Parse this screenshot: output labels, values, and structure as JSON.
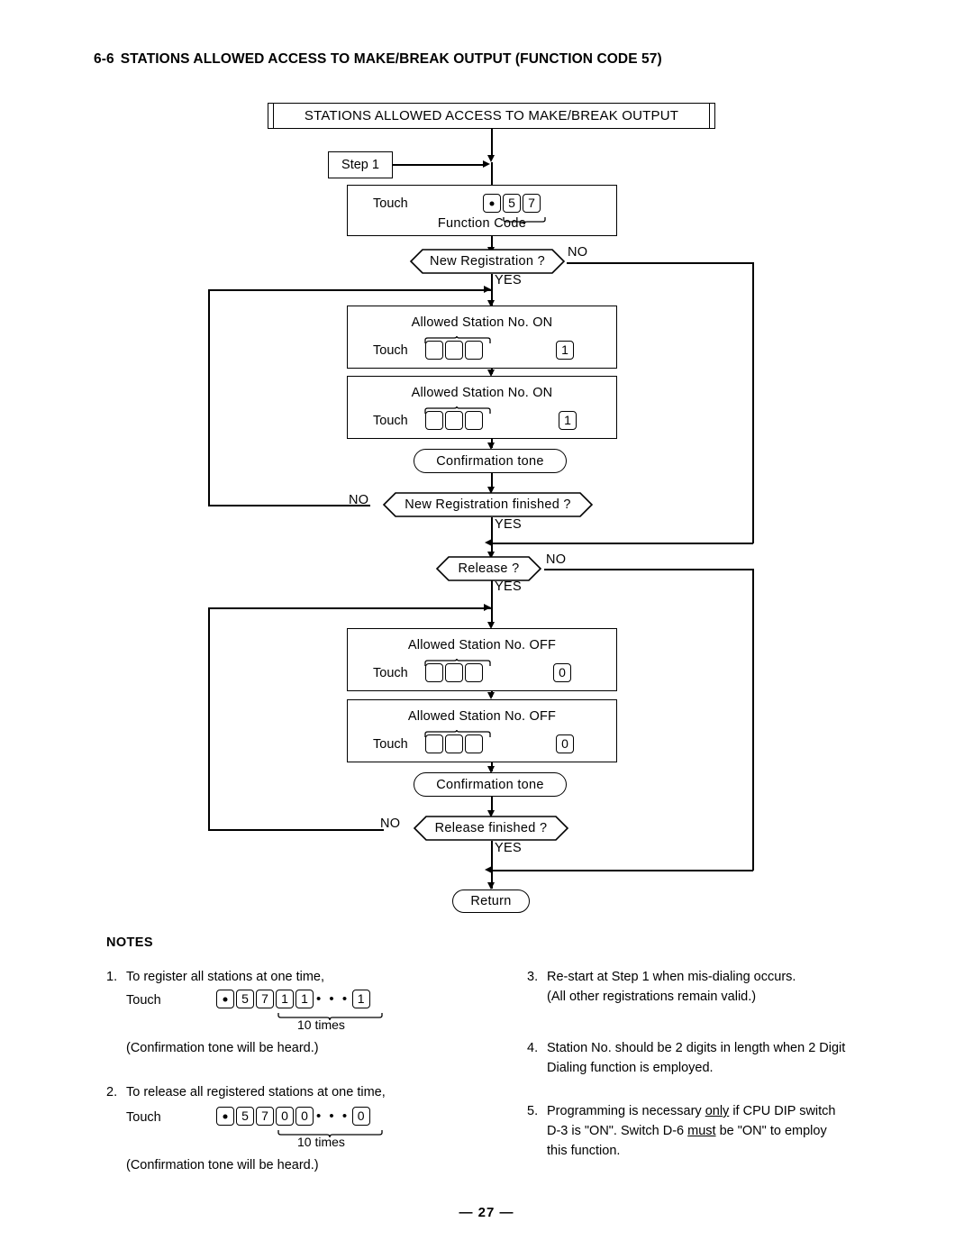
{
  "document": {
    "section_number": "6-6",
    "section_title": "STATIONS ALLOWED ACCESS TO  MAKE/BREAK  OUTPUT (FUNCTION CODE 57)",
    "page_number": "— 27 —"
  },
  "flow": {
    "header": "STATIONS ALLOWED ACCESS TO MAKE/BREAK OUTPUT",
    "step_label": "Step  1",
    "touch_label": "Touch",
    "function_code": {
      "keys": [
        "•",
        "5",
        "7"
      ],
      "brace_caption": "Function Code"
    },
    "decisions": {
      "new_registration": {
        "label": "New Registration ?",
        "yes": "YES",
        "no": "NO"
      },
      "new_registration_finished": {
        "label": "New  Registration  finished  ?",
        "yes": "YES",
        "no": "NO"
      },
      "release": {
        "label": "Release  ?",
        "yes": "YES",
        "no": "NO"
      },
      "release_finished": {
        "label": "Release  finished  ?",
        "yes": "YES",
        "no": "NO"
      }
    },
    "on_box_1": {
      "heading": "Allowed  Station  No.   ON",
      "touch": "Touch",
      "station_keys": [
        "",
        "",
        ""
      ],
      "state_key": "1"
    },
    "on_box_2": {
      "heading": "Allowed  Station  No.   ON",
      "touch": "Touch",
      "station_keys": [
        "",
        "",
        ""
      ],
      "state_key": "1"
    },
    "off_box_1": {
      "heading": "Allowed  Station  No.  OFF",
      "touch": "Touch",
      "station_keys": [
        "",
        "",
        ""
      ],
      "state_key": "0"
    },
    "off_box_2": {
      "heading": "Allowed  Station  No.  OFF",
      "touch": "Touch",
      "station_keys": [
        "",
        "",
        ""
      ],
      "state_key": "0"
    },
    "confirmation_tone_1": "Confirmation  tone",
    "confirmation_tone_2": "Confirmation  tone",
    "return": "Return"
  },
  "notes": {
    "heading": "NOTES",
    "items": [
      {
        "num": "1.",
        "text": "To register all stations at one time,",
        "touch": "Touch",
        "keys": [
          "•",
          "5",
          "7",
          "1",
          "1"
        ],
        "ellipsis": "• • •",
        "tail_key": "1",
        "brace_caption": "10 times",
        "footer": "(Confirmation tone will be heard.)"
      },
      {
        "num": "2.",
        "text": "To release all registered stations at one time,",
        "touch": "Touch",
        "keys": [
          "•",
          "5",
          "7",
          "0",
          "0"
        ],
        "ellipsis": "• • •",
        "tail_key": "0",
        "brace_caption": "10 times",
        "footer": "(Confirmation tone will be heard.)"
      },
      {
        "num": "3.",
        "line1": "Re-start at Step  1 when mis-dialing occurs.",
        "line2": "(All other registrations remain valid.)"
      },
      {
        "num": "4.",
        "line1": "Station  No.  should  be  2 digits  in  length  when  2 Digit",
        "line2": "Dialing function is employed."
      },
      {
        "num": "5.",
        "part1": "Programming  is  necessary",
        "em1": "only",
        "part2": "if CPU  DIP  switch",
        "part3": "D-3  is  \"ON\".   Switch  D-6",
        "em2": "must",
        "part4": "be  \"ON\"  to employ",
        "part5": "this function."
      }
    ]
  }
}
